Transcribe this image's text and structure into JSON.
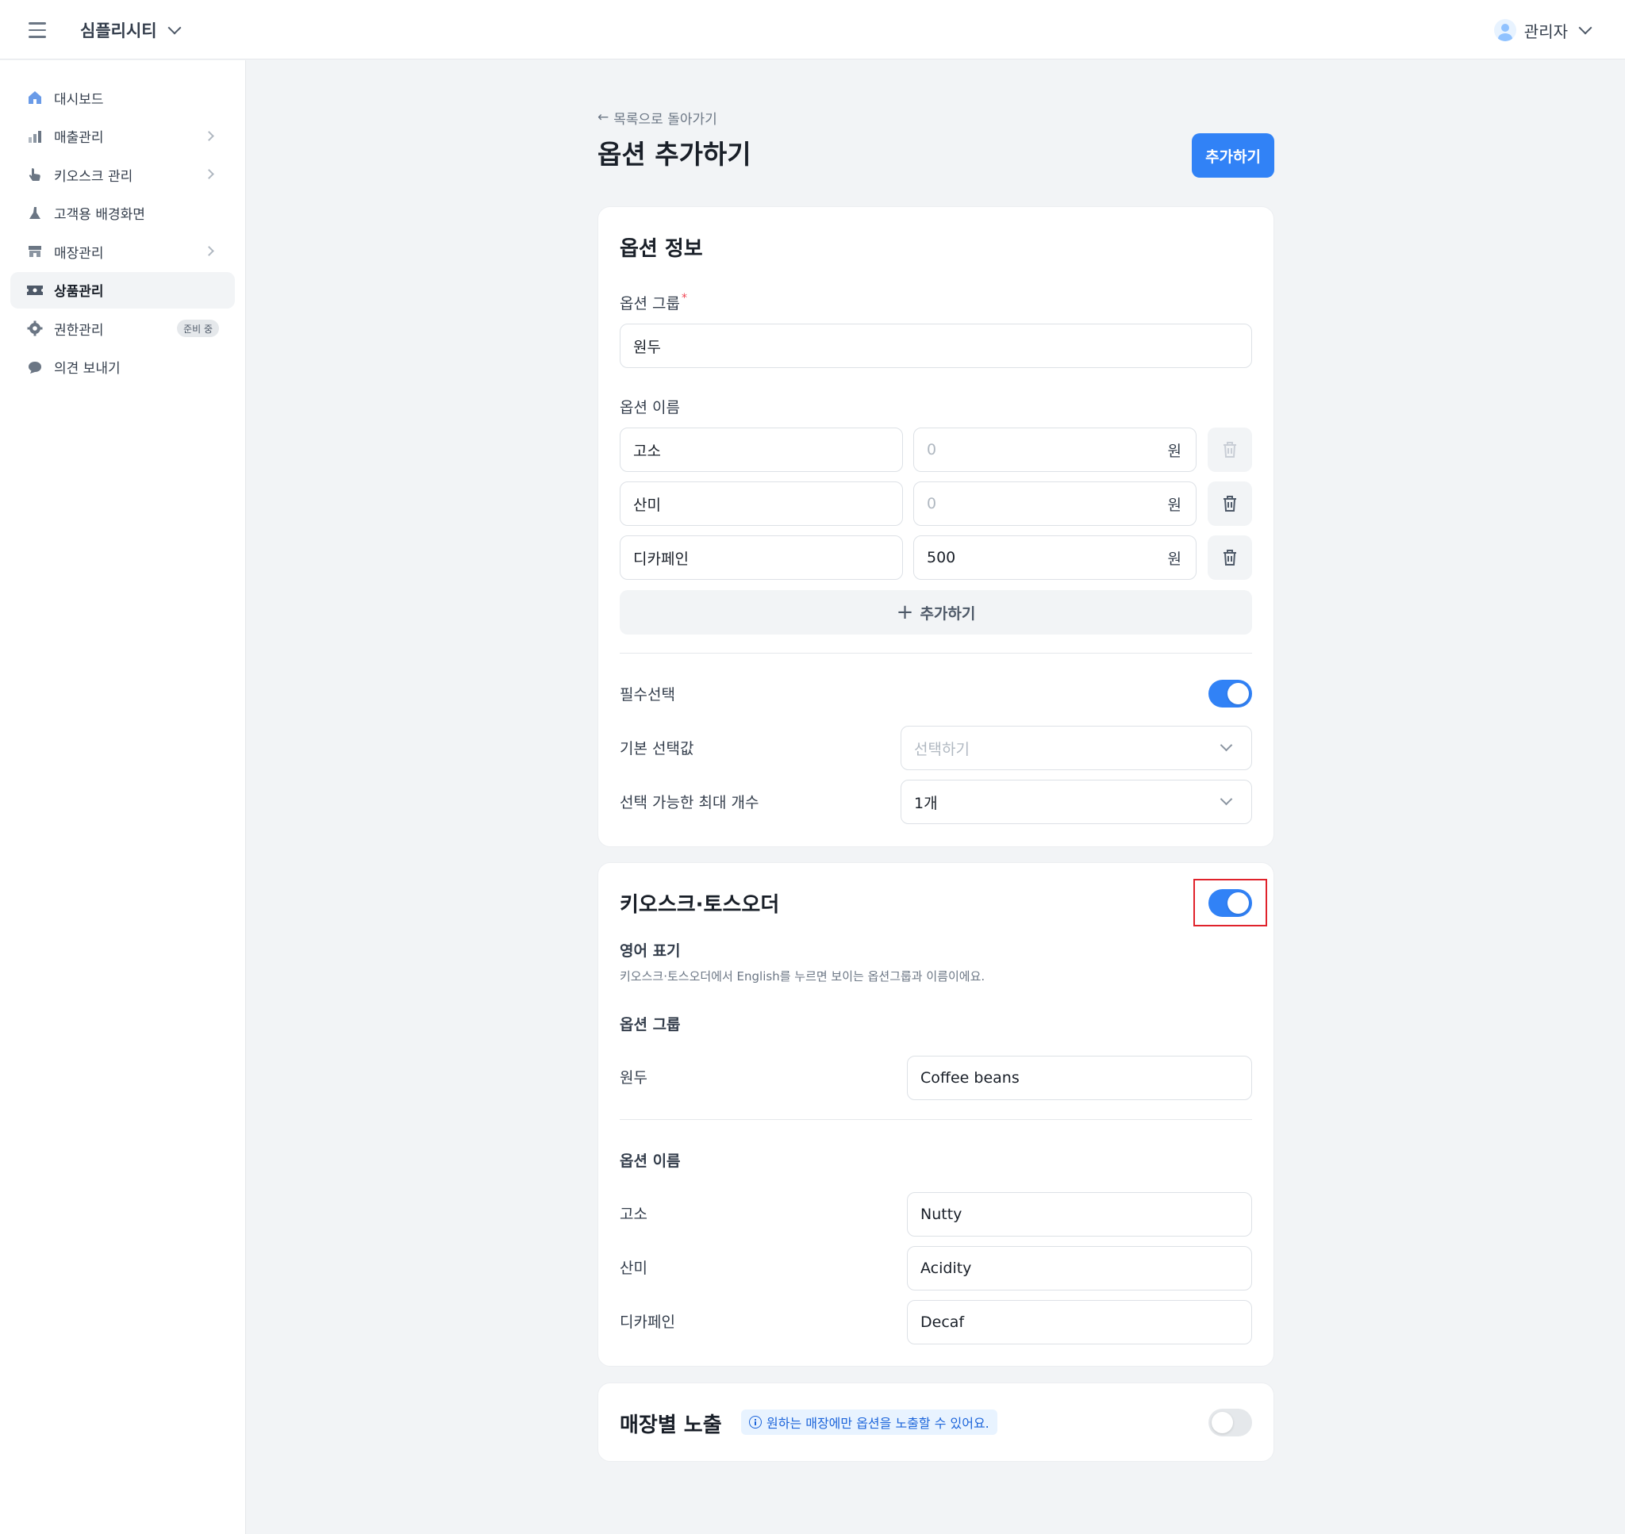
{
  "header": {
    "store_name": "심플리시티",
    "user_name": "관리자"
  },
  "sidebar": {
    "items": [
      {
        "label": "대시보드",
        "icon": "home-icon"
      },
      {
        "label": "매출관리",
        "icon": "bar-chart-icon"
      },
      {
        "label": "키오스크 관리",
        "icon": "hand-pointer-icon"
      },
      {
        "label": "고객용 배경화면",
        "icon": "brush-icon"
      },
      {
        "label": "매장관리",
        "icon": "store-icon"
      },
      {
        "label": "상품관리",
        "icon": "ticket-icon"
      },
      {
        "label": "권한관리",
        "icon": "gear-icon",
        "badge": "준비 중"
      },
      {
        "label": "의견 보내기",
        "icon": "chat-bubble-icon"
      }
    ]
  },
  "page": {
    "back_label": "목록으로 돌아가기",
    "title": "옵션 추가하기",
    "submit_label": "추가하기"
  },
  "option_info": {
    "title": "옵션 정보",
    "group_label": "옵션 그룹",
    "group_value": "원두",
    "name_label": "옵션 이름",
    "currency": "원",
    "options": [
      {
        "name": "고소",
        "price": "0",
        "price_is_placeholder": true
      },
      {
        "name": "산미",
        "price": "0",
        "price_is_placeholder": true
      },
      {
        "name": "디카페인",
        "price": "500",
        "price_is_placeholder": false
      }
    ],
    "add_label": "추가하기",
    "required_label": "필수선택",
    "required_on": true,
    "default_label": "기본 선택값",
    "default_placeholder": "선택하기",
    "max_label": "선택 가능한 최대 개수",
    "max_value": "1개"
  },
  "kiosk": {
    "title": "키오스크·토스오더",
    "enabled": true,
    "english_label": "영어 표기",
    "english_desc": "키오스크·토스오더에서 English를 누르면 보이는 옵션그룹과 이름이에요.",
    "group_heading": "옵션 그룹",
    "group_ko": "원두",
    "group_en": "Coffee beans",
    "name_heading": "옵션 이름",
    "names": [
      {
        "ko": "고소",
        "en": "Nutty"
      },
      {
        "ko": "산미",
        "en": "Acidity"
      },
      {
        "ko": "디카페인",
        "en": "Decaf"
      }
    ]
  },
  "store_exposure": {
    "title": "매장별 노출",
    "info": "원하는 매장에만 옵션을 노출할 수 있어요.",
    "enabled": false
  },
  "colors": {
    "accent": "#3182f6",
    "highlight_border": "#e0222b"
  }
}
